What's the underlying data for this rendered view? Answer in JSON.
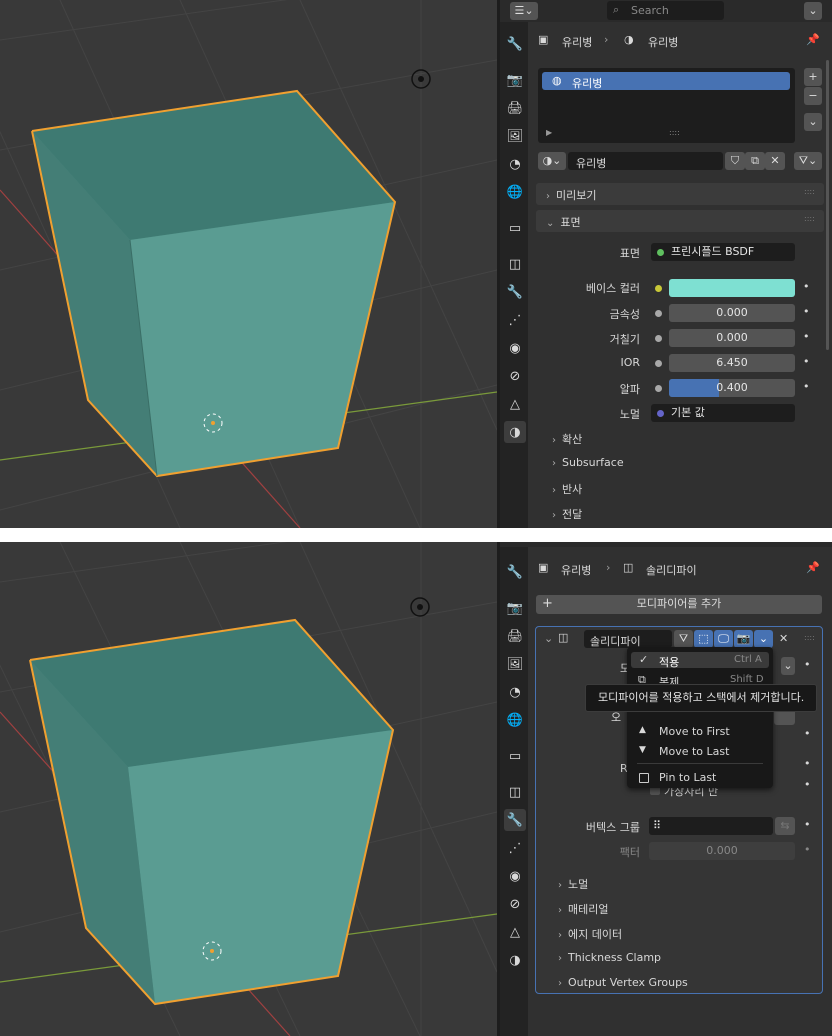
{
  "top": {
    "header": {
      "search_placeholder": "Search"
    },
    "breadcrumb": {
      "object": "유리병",
      "material": "유리병"
    },
    "material_slots": [
      "유리병"
    ],
    "material_name": "유리병",
    "sections": {
      "preview": "미리보기",
      "surface": "표면"
    },
    "surface": {
      "surface_label": "표면",
      "surface_value": "프린시플드 BSDF",
      "base_color_label": "베이스 컬러",
      "base_color_hex": "#7ee0d2",
      "metallic_label": "금속성",
      "metallic_value": "0.000",
      "roughness_label": "거칠기",
      "roughness_value": "0.000",
      "ior_label": "IOR",
      "ior_value": "6.450",
      "alpha_label": "알파",
      "alpha_value": "0.400",
      "alpha_fraction": 0.4,
      "normal_label": "노멀",
      "normal_value": "기본 값"
    },
    "subsections": [
      "확산",
      "Subsurface",
      "반사",
      "전달"
    ]
  },
  "bottom": {
    "breadcrumb": {
      "object": "유리병",
      "modifier": "솔리디파이"
    },
    "add_modifier_label": "모디파이어를 추가",
    "modifier_name": "솔리디파이",
    "dropdown": {
      "apply_label": "적용",
      "apply_shortcut": "Ctrl A",
      "duplicate_label": "복제",
      "duplicate_shortcut": "Shift D",
      "move_first_label": "Move to First",
      "move_last_label": "Move to Last",
      "pin_last_label": "Pin to Last"
    },
    "tooltip": "모디파이어를 적용하고 스택에서 제거합니다.",
    "partial_labels": {
      "mode": "모",
      "offset": "오",
      "rim": "Ri",
      "rim_only": "가장자리 만"
    },
    "vertex_group_label": "버텍스 그룹",
    "factor_label": "팩터",
    "factor_value": "0.000",
    "subsections": [
      "노멀",
      "매테리얼",
      "에지 데이터",
      "Thickness Clamp",
      "Output Vertex Groups"
    ]
  },
  "colors": {
    "accent_blue": "#4772b3",
    "selection_orange": "#f0a030",
    "object_teal": "#4a8a80"
  }
}
